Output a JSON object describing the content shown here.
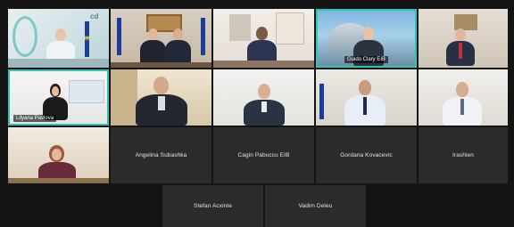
{
  "participants": [
    {
      "id": "p1",
      "name": ""
    },
    {
      "id": "p2",
      "name": ""
    },
    {
      "id": "p3",
      "name": ""
    },
    {
      "id": "p4",
      "name": "Guido Clary EIB"
    },
    {
      "id": "p5",
      "name": ""
    },
    {
      "id": "p6",
      "name": "Lilyana Pavlova"
    },
    {
      "id": "p7",
      "name": ""
    },
    {
      "id": "p8",
      "name": ""
    },
    {
      "id": "p9",
      "name": ""
    },
    {
      "id": "p10",
      "name": ""
    },
    {
      "id": "p11",
      "name": ""
    },
    {
      "id": "p12",
      "name": "Angelina Subashka"
    },
    {
      "id": "p13",
      "name": "Cagin Pabuccu EIB"
    },
    {
      "id": "p14",
      "name": "Gordana Kovacevic"
    },
    {
      "id": "p15",
      "name": "Irashlen"
    },
    {
      "id": "p16",
      "name": "Stefan Acxinte"
    },
    {
      "id": "p17",
      "name": "Vadim Deleu"
    }
  ],
  "tile1_logo": "cd"
}
